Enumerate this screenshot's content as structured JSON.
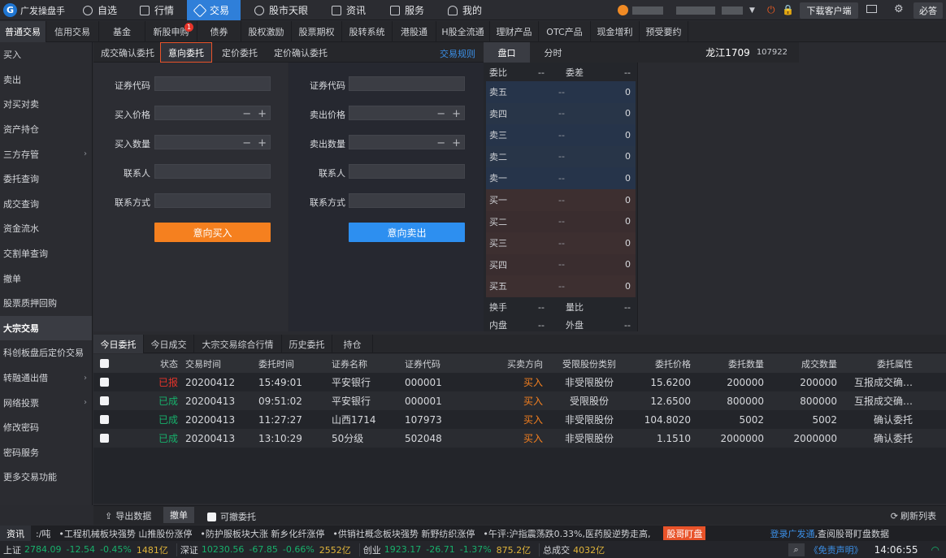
{
  "app": {
    "name": "广发操盘手"
  },
  "nav": [
    {
      "label": "自选",
      "icon": "star-icon"
    },
    {
      "label": "行情",
      "icon": "chart-icon"
    },
    {
      "label": "交易",
      "icon": "trade-icon"
    },
    {
      "label": "股市天眼",
      "icon": "eye-icon"
    },
    {
      "label": "资讯",
      "icon": "news-icon"
    },
    {
      "label": "服务",
      "icon": "briefcase-icon"
    },
    {
      "label": "我的",
      "icon": "user-icon"
    }
  ],
  "header": {
    "download_label": "下载客户端",
    "help_label": "必答"
  },
  "subtabs": [
    "普通交易",
    "信用交易",
    "基金",
    "新股申购",
    "债券",
    "股权激励",
    "股票期权",
    "股转系统",
    "港股通",
    "H股全流通",
    "理财产品",
    "OTC产品",
    "现金增利",
    "预受要约"
  ],
  "subtab_badge": "1",
  "sidebar": [
    "买入",
    "卖出",
    "对买对卖",
    "资产持仓",
    "三方存管",
    "委托查询",
    "成交查询",
    "资金流水",
    "交割单查询",
    "撤单",
    "股票质押回购",
    "大宗交易",
    "科创板盘后定价交易",
    "转融通出借",
    "网络投票",
    "修改密码",
    "密码服务",
    "更多交易功能"
  ],
  "form_tabs": [
    "成交确认委托",
    "意向委托",
    "定价委托",
    "定价确认委托"
  ],
  "rules_link": "交易规则",
  "buy_form": {
    "labels": [
      "证券代码",
      "买入价格",
      "买入数量",
      "联系人",
      "联系方式"
    ],
    "submit": "意向买入"
  },
  "sell_form": {
    "labels": [
      "证券代码",
      "卖出价格",
      "卖出数量",
      "联系人",
      "联系方式"
    ],
    "submit": "意向卖出"
  },
  "orderbook": {
    "tabs": [
      "盘口",
      "分时"
    ],
    "stock_name": "龙江1709",
    "stock_code": "107922",
    "ratio": {
      "label1": "委比",
      "val1": "--",
      "label2": "委差",
      "val2": "--"
    },
    "rows": [
      {
        "name": "卖五",
        "price": "--",
        "vol": "0"
      },
      {
        "name": "卖四",
        "price": "--",
        "vol": "0"
      },
      {
        "name": "卖三",
        "price": "--",
        "vol": "0"
      },
      {
        "name": "卖二",
        "price": "--",
        "vol": "0"
      },
      {
        "name": "卖一",
        "price": "--",
        "vol": "0"
      },
      {
        "name": "买一",
        "price": "--",
        "vol": "0"
      },
      {
        "name": "买二",
        "price": "--",
        "vol": "0"
      },
      {
        "name": "买三",
        "price": "--",
        "vol": "0"
      },
      {
        "name": "买四",
        "price": "--",
        "vol": "0"
      },
      {
        "name": "买五",
        "price": "--",
        "vol": "0"
      }
    ],
    "info": [
      {
        "label1": "换手",
        "val1": "--",
        "label2": "量比",
        "val2": "--"
      },
      {
        "label1": "内盘",
        "val1": "--",
        "label2": "外盘",
        "val2": "--"
      }
    ]
  },
  "bottom_tabs": [
    "今日委托",
    "今日成交",
    "大宗交易综合行情",
    "历史委托",
    "持仓"
  ],
  "table": {
    "headers": [
      "状态",
      "交易时间",
      "委托时间",
      "证券名称",
      "证券代码",
      "买卖方向",
      "受限股份类别",
      "委托价格",
      "委托数量",
      "成交数量",
      "委托属性"
    ],
    "rows": [
      [
        "已报",
        "20200412",
        "15:49:01",
        "平安银行",
        "000001",
        "买入",
        "非受限股份",
        "15.6200",
        "200000",
        "200000",
        "互报成交确…"
      ],
      [
        "已成",
        "20200413",
        "09:51:02",
        "平安银行",
        "000001",
        "买入",
        "受限股份",
        "12.6500",
        "800000",
        "800000",
        "互报成交确…"
      ],
      [
        "已成",
        "20200413",
        "11:27:27",
        "山西1714",
        "107973",
        "买入",
        "非受限股份",
        "104.8020",
        "5002",
        "5002",
        "确认委托"
      ],
      [
        "已成",
        "20200413",
        "13:10:29",
        "50分级",
        "502048",
        "买入",
        "非受限股份",
        "1.1510",
        "2000000",
        "2000000",
        "确认委托"
      ]
    ]
  },
  "footer": {
    "export": "导出数据",
    "cancel": "撤单",
    "cancellable": "可撤委托",
    "refresh": "刷新列表"
  },
  "ticker": {
    "label": "资讯",
    "items": [
      ":/吨",
      "•工程机械板块强势 山推股份涨停",
      "•防护服板块大涨 新乡化纤涨停",
      "•供销社概念板块强势 新野纺织涨停",
      "•午评:沪指震荡跌0.33%,医药股逆势走高,"
    ],
    "promo": "股哥盯盘",
    "login": "登录广发通",
    "login_tail": ",查阅股哥盯盘数据"
  },
  "status": {
    "sh": {
      "name": "上证",
      "price": "2784.09",
      "chg": "-12.54",
      "pct": "-0.45%",
      "amt": "1481亿"
    },
    "sz": {
      "name": "深证",
      "price": "10230.56",
      "chg": "-67.85",
      "pct": "-0.66%",
      "amt": "2552亿"
    },
    "cy": {
      "name": "创业",
      "price": "1923.17",
      "chg": "-26.71",
      "pct": "-1.37%",
      "amt": "875.2亿"
    },
    "total_label": "总成交",
    "total": "4032亿",
    "disclaimer": "《免责声明》",
    "time": "14:06:55"
  },
  "colors": {
    "accent": "#2f7fd9",
    "buy": "#f5801f",
    "sell": "#2d8ff0",
    "red": "#e6342a",
    "green": "#17b06b"
  }
}
